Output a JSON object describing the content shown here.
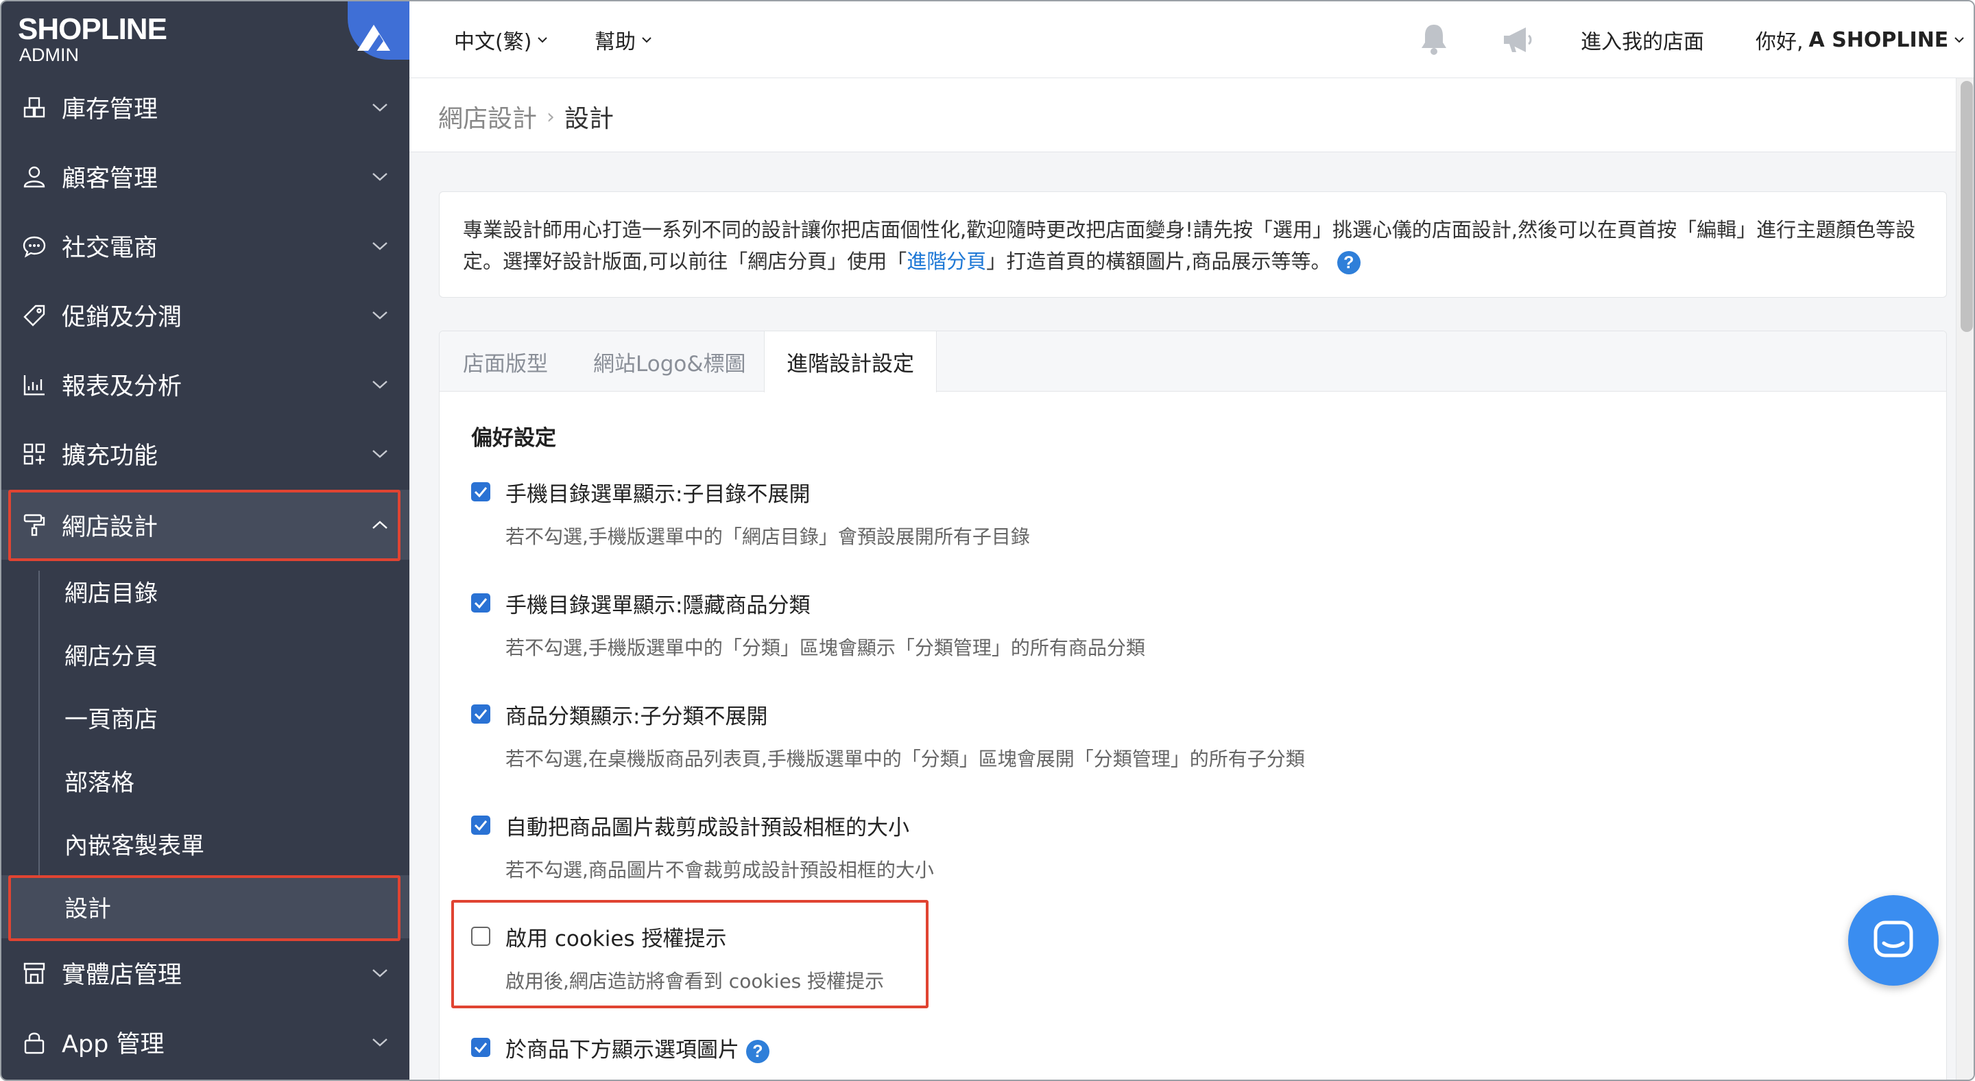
{
  "brand": {
    "name": "SHOPLINE",
    "sub": "ADMIN"
  },
  "sidebar": {
    "items": [
      {
        "label": "庫存管理",
        "icon": "inventory-icon"
      },
      {
        "label": "顧客管理",
        "icon": "user-icon"
      },
      {
        "label": "社交電商",
        "icon": "chat-bubble-icon"
      },
      {
        "label": "促銷及分潤",
        "icon": "tag-icon"
      },
      {
        "label": "報表及分析",
        "icon": "bar-chart-icon"
      },
      {
        "label": "擴充功能",
        "icon": "apps-plus-icon"
      },
      {
        "label": "網店設計",
        "icon": "paint-roller-icon",
        "expanded": true
      },
      {
        "label": "實體店管理",
        "icon": "store-icon"
      },
      {
        "label": "App 管理",
        "icon": "lock-icon"
      }
    ],
    "design_sub": [
      "網店目錄",
      "網店分頁",
      "一頁商店",
      "部落格",
      "內嵌客製表單",
      "設計"
    ],
    "current_sub": "設計"
  },
  "topbar": {
    "language": "中文(繁)",
    "help": "幫助",
    "store_link": "進入我的店面",
    "greeting": "你好,",
    "user": "A SHOPLINE"
  },
  "breadcrumb": {
    "parent": "網店設計",
    "current": "設計"
  },
  "notice": {
    "part1": "專業設計師用心打造一系列不同的設計讓你把店面個性化,歡迎隨時更改把店面變身!請先按「選用」挑選心儀的店面設計,然後可以在頁首按「編輯」進行主題顏色等設定。選擇好設計版面,可以前往「網店分頁」使用「",
    "link": "進階分頁",
    "part2": "」打造首頁的橫額圖片,商品展示等等。"
  },
  "tabs": [
    {
      "label": "店面版型",
      "active": false
    },
    {
      "label": "網站Logo&標圖",
      "active": false
    },
    {
      "label": "進階設計設定",
      "active": true
    }
  ],
  "preferences": {
    "title": "偏好設定",
    "options": [
      {
        "label": "手機目錄選單顯示:子目錄不展開",
        "desc": "若不勾選,手機版選單中的「網店目錄」會預設展開所有子目錄",
        "checked": true
      },
      {
        "label": "手機目錄選單顯示:隱藏商品分類",
        "desc": "若不勾選,手機版選單中的「分類」區塊會顯示「分類管理」的所有商品分類",
        "checked": true
      },
      {
        "label": "商品分類顯示:子分類不展開",
        "desc": "若不勾選,在桌機版商品列表頁,手機版選單中的「分類」區塊會展開「分類管理」的所有子分類",
        "checked": true
      },
      {
        "label": "自動把商品圖片裁剪成設計預設相框的大小",
        "desc": "若不勾選,商品圖片不會裁剪成設計預設相框的大小",
        "checked": true
      },
      {
        "label": "啟用 cookies 授權提示",
        "desc": "啟用後,網店造訪將會看到 cookies 授權提示",
        "checked": false
      },
      {
        "label": "於商品下方顯示選項圖片",
        "desc": "",
        "checked": true
      }
    ]
  },
  "colors": {
    "sidebar_bg": "#353b4a",
    "accent": "#2a72d4",
    "highlight_border": "#e04432",
    "chat": "#3a8df0"
  }
}
